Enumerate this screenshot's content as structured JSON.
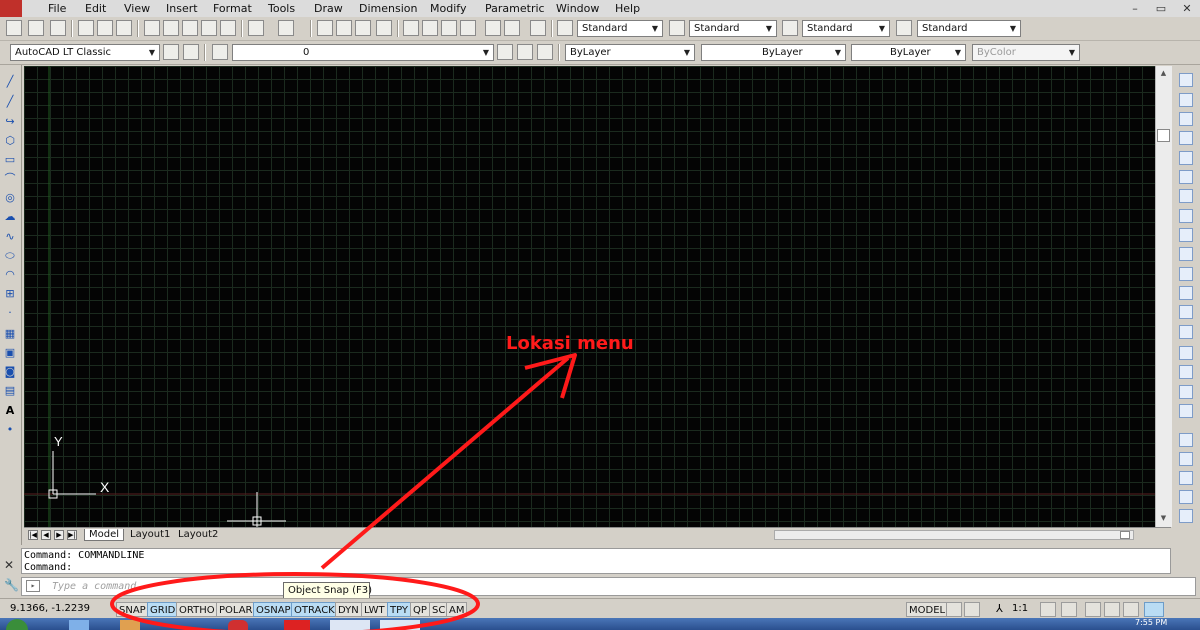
{
  "menubar": {
    "items": [
      "File",
      "Edit",
      "View",
      "Insert",
      "Format",
      "Tools",
      "Draw",
      "Dimension",
      "Modify",
      "Parametric",
      "Window",
      "Help"
    ],
    "window_buttons": [
      "–",
      "▭",
      "✕"
    ]
  },
  "styles_toolbar": {
    "text_style": "Standard",
    "dim_style": "Standard",
    "table_style": "Standard",
    "mleader_style": "Standard"
  },
  "workspace": {
    "name": "AutoCAD LT Classic"
  },
  "layer": {
    "current": "0"
  },
  "properties": {
    "color": "ByLayer",
    "linetype": "ByLayer",
    "lineweight": "ByLayer",
    "plot_style": "ByColor"
  },
  "ucs": {
    "x_label": "X",
    "y_label": "Y"
  },
  "layout_tabs": {
    "model": "Model",
    "layout1": "Layout1",
    "layout2": "Layout2"
  },
  "command": {
    "history": [
      "Command: COMMANDLINE",
      "Command:"
    ],
    "placeholder": "Type a command"
  },
  "tooltip": "Object Snap (F3)",
  "annotation": {
    "text": "Lokasi menu",
    "color": "#ff1a1a"
  },
  "statusbar": {
    "coords": "9.1366, -1.2239",
    "toggles": [
      {
        "label": "SNAP",
        "on": false
      },
      {
        "label": "GRID",
        "on": true
      },
      {
        "label": "ORTHO",
        "on": false
      },
      {
        "label": "POLAR",
        "on": false
      },
      {
        "label": "OSNAP",
        "on": true
      },
      {
        "label": "OTRACK",
        "on": true
      },
      {
        "label": "DYN",
        "on": false
      },
      {
        "label": "LWT",
        "on": false
      },
      {
        "label": "TPY",
        "on": true
      },
      {
        "label": "QP",
        "on": false
      },
      {
        "label": "SC",
        "on": false
      },
      {
        "label": "AM",
        "on": false
      }
    ],
    "model_label": "MODEL",
    "scale": "1:1"
  },
  "taskbar": {
    "time": "7:55 PM"
  },
  "colors": {
    "canvas_bg": "#040404",
    "grid": "#1b2a1e",
    "highlight_red": "#ff1a1a"
  }
}
